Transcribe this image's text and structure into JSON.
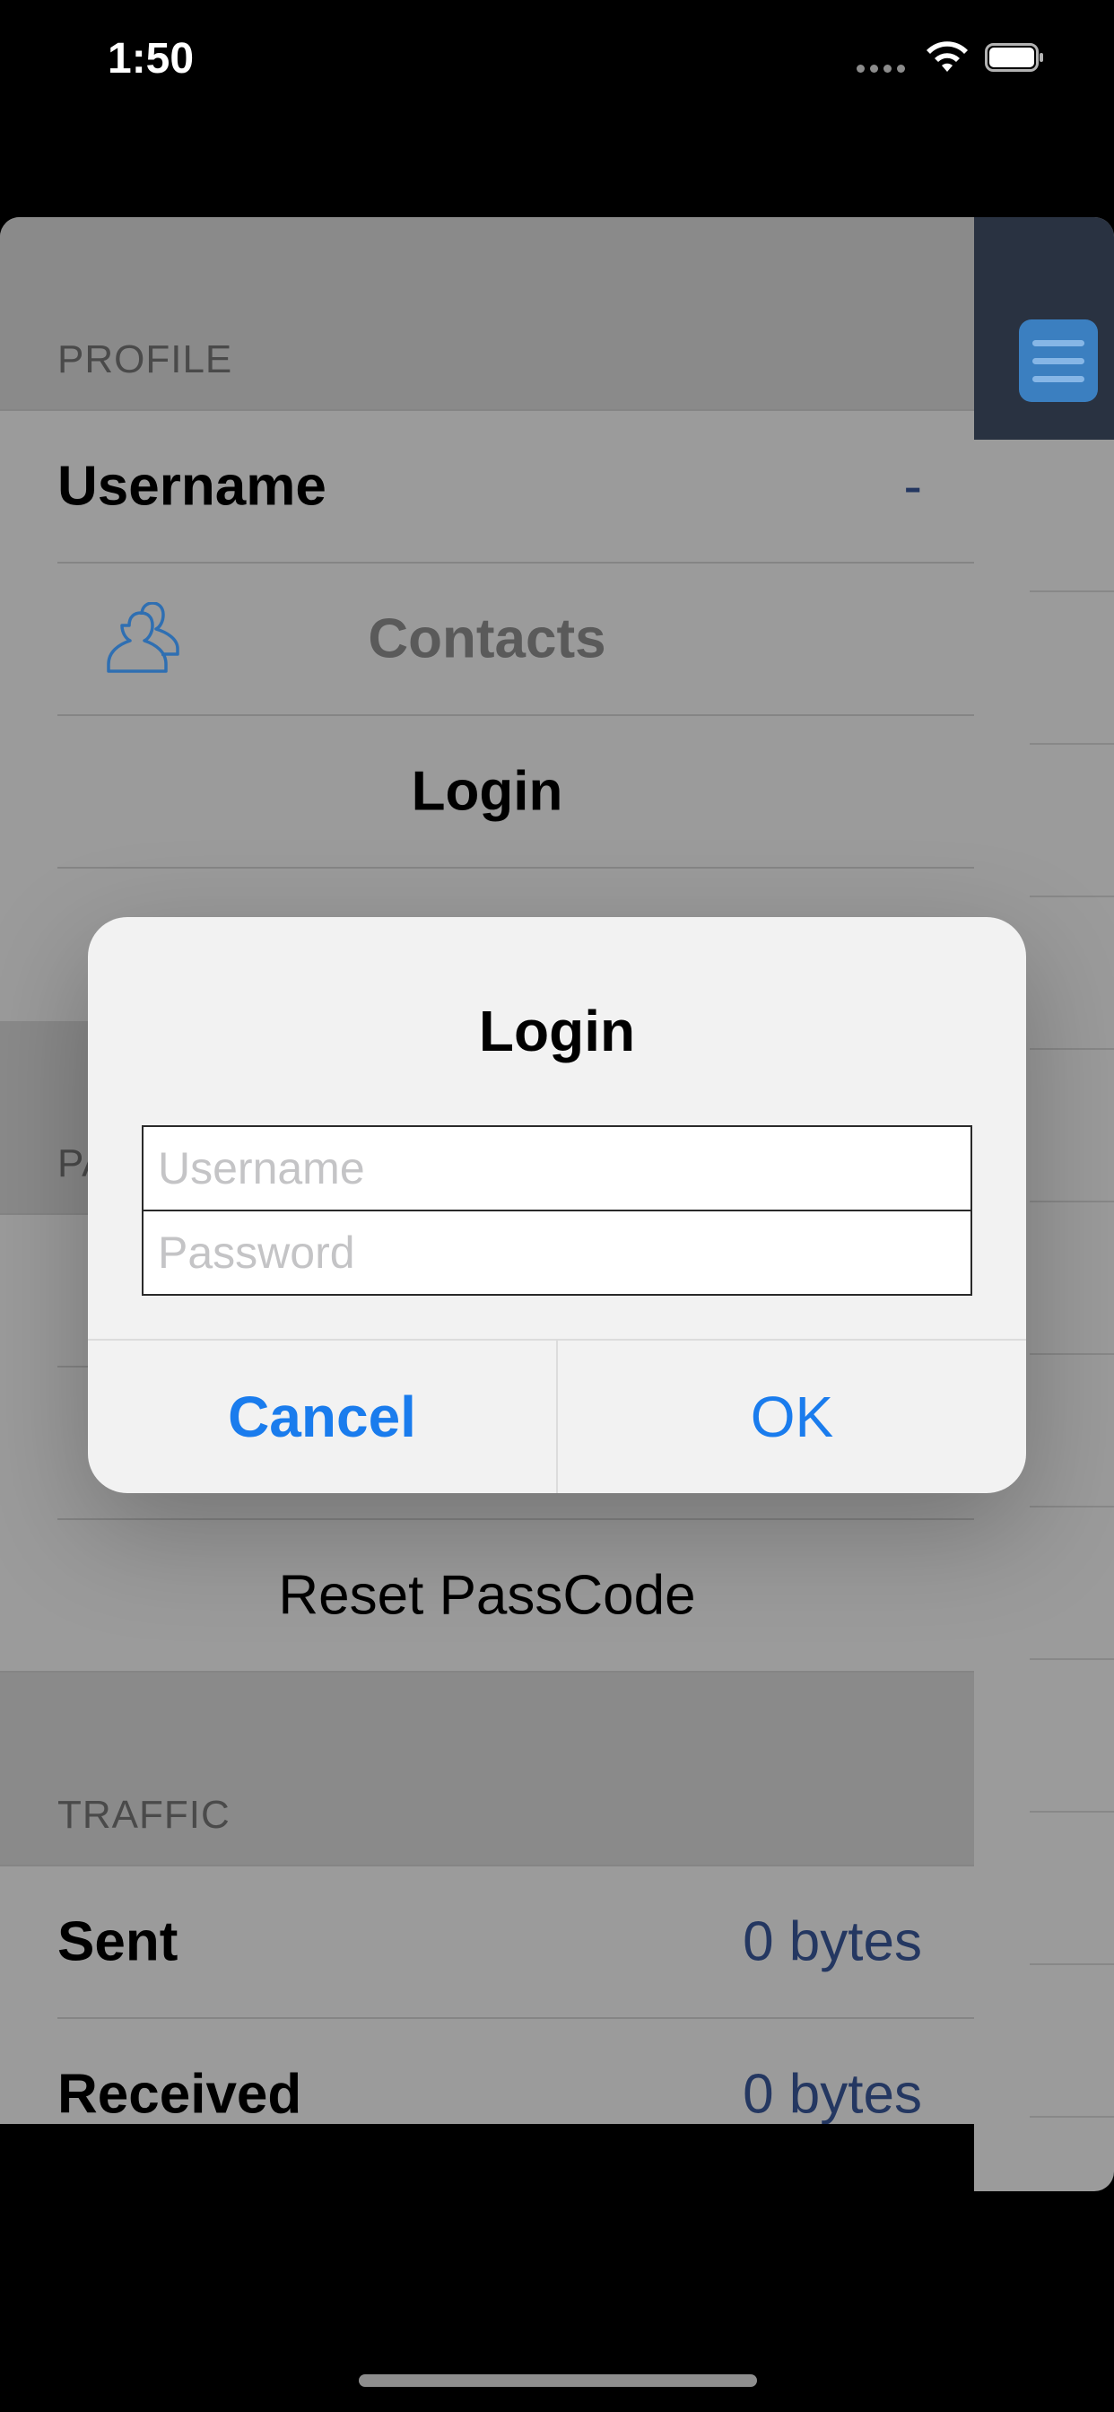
{
  "status_bar": {
    "time": "1:50"
  },
  "sections": {
    "profile": {
      "header": "PROFILE",
      "username_label": "Username",
      "username_value": "-",
      "contacts_label": "Contacts",
      "login_label": "Login"
    },
    "passcode": {
      "header_partial": "PA",
      "reset_label": "Reset PassCode"
    },
    "traffic": {
      "header": "TRAFFIC",
      "sent_label": "Sent",
      "sent_value": "0 bytes",
      "received_label": "Received",
      "received_value": "0 bytes"
    }
  },
  "dialog": {
    "title": "Login",
    "username_placeholder": "Username",
    "password_placeholder": "Password",
    "cancel_label": "Cancel",
    "ok_label": "OK"
  },
  "colors": {
    "accent": "#1a7ced",
    "value_text": "#243761",
    "menu_button": "#3b7fc0",
    "side_header": "#293241"
  },
  "icons": [
    "contacts-icon",
    "menu-icon",
    "wifi-icon",
    "battery-icon",
    "signal-icon"
  ]
}
